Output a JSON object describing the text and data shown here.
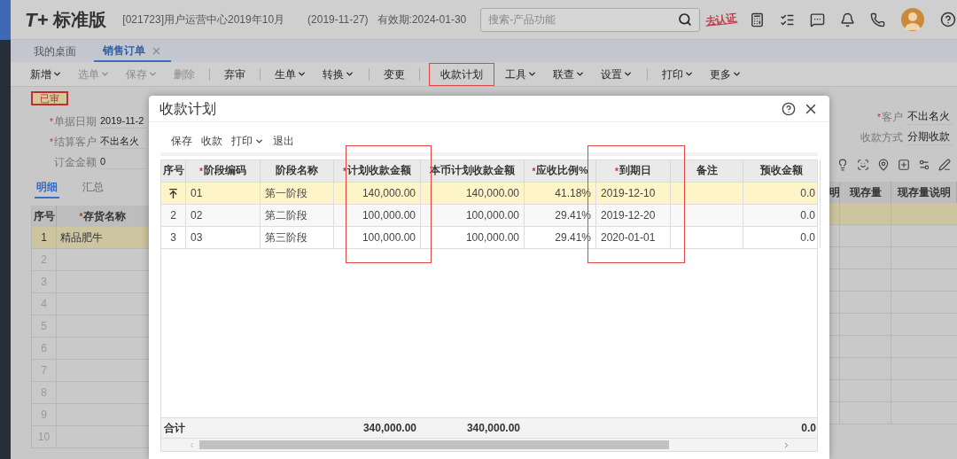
{
  "header": {
    "logo_mark": "T+",
    "product": "标准版",
    "account": "[021723]用户运营中心2019年10月",
    "date": "(2019-11-27)",
    "validity": "有效期:2024-01-30",
    "search": {
      "placeholder": "搜索-产品功能"
    },
    "certify_link": "去认证"
  },
  "tabs": [
    {
      "label": "我的桌面",
      "selected": false,
      "closable": false
    },
    {
      "label": "销售订单",
      "selected": true,
      "closable": true
    }
  ],
  "toolbar": [
    {
      "kind": "button",
      "label": "新增",
      "dropdown": true,
      "disabled": false,
      "highlighted": false
    },
    {
      "kind": "button",
      "label": "选单",
      "dropdown": true,
      "disabled": true,
      "highlighted": false
    },
    {
      "kind": "button",
      "label": "保存",
      "dropdown": true,
      "disabled": true,
      "highlighted": false
    },
    {
      "kind": "button",
      "label": "删除",
      "dropdown": false,
      "disabled": true,
      "highlighted": false
    },
    {
      "kind": "separator"
    },
    {
      "kind": "button",
      "label": "弃审",
      "dropdown": false,
      "disabled": false,
      "highlighted": false
    },
    {
      "kind": "separator"
    },
    {
      "kind": "button",
      "label": "生单",
      "dropdown": true,
      "disabled": false,
      "highlighted": false
    },
    {
      "kind": "button",
      "label": "转换",
      "dropdown": true,
      "disabled": false,
      "highlighted": false
    },
    {
      "kind": "separator"
    },
    {
      "kind": "button",
      "label": "变更",
      "dropdown": false,
      "disabled": false,
      "highlighted": false
    },
    {
      "kind": "separator"
    },
    {
      "kind": "button",
      "label": "收款计划",
      "dropdown": false,
      "disabled": false,
      "highlighted": true
    },
    {
      "kind": "button",
      "label": "工具",
      "dropdown": true,
      "disabled": false,
      "highlighted": false
    },
    {
      "kind": "button",
      "label": "联查",
      "dropdown": true,
      "disabled": false,
      "highlighted": false
    },
    {
      "kind": "button",
      "label": "设置",
      "dropdown": true,
      "disabled": false,
      "highlighted": false
    },
    {
      "kind": "separator"
    },
    {
      "kind": "button",
      "label": "打印",
      "dropdown": true,
      "disabled": false,
      "highlighted": false
    },
    {
      "kind": "button",
      "label": "更多",
      "dropdown": true,
      "disabled": false,
      "highlighted": false
    }
  ],
  "form": {
    "status": "已审",
    "fields_left": [
      {
        "mark": "*",
        "label": "单据日期",
        "value": "2019-11-2"
      },
      {
        "mark": "*",
        "label": "结算客户",
        "value": "不出名火"
      },
      {
        "label": "订金金额",
        "value": "0"
      }
    ],
    "fields_right": [
      {
        "mark": "*",
        "label": "客户",
        "value": "不出名火"
      },
      {
        "label": "收款方式",
        "value": "分期收款"
      }
    ]
  },
  "detail_tabs": [
    {
      "label": "明细",
      "selected": true
    },
    {
      "label": "汇总",
      "selected": false
    }
  ],
  "grid": {
    "columns_left": [
      {
        "label": "序号"
      },
      {
        "mark": "*",
        "label": "存货名称"
      }
    ],
    "columns_right": [
      {
        "label": "明"
      },
      {
        "label": "现存量"
      },
      {
        "label": "现存量说明"
      }
    ],
    "rows": [
      {
        "seq": "1",
        "name": "精品肥牛",
        "selected": true
      },
      {
        "seq": "2",
        "selected": false
      },
      {
        "seq": "3",
        "selected": false
      },
      {
        "seq": "4",
        "selected": false
      },
      {
        "seq": "5",
        "selected": false
      },
      {
        "seq": "6",
        "selected": false
      },
      {
        "seq": "7",
        "selected": false
      },
      {
        "seq": "8",
        "selected": false
      },
      {
        "seq": "9",
        "selected": false
      },
      {
        "seq": "10",
        "selected": false
      }
    ]
  },
  "modal": {
    "title": "收款计划",
    "toolbar": [
      {
        "label": "保存",
        "dropdown": false
      },
      {
        "label": "收款",
        "dropdown": false
      },
      {
        "label": "打印",
        "dropdown": true
      },
      {
        "label": "退出",
        "dropdown": false
      }
    ],
    "columns": [
      {
        "label": "序号",
        "highlighted": false
      },
      {
        "mark": "*",
        "label": "阶段编码",
        "highlighted": false
      },
      {
        "label": "阶段名称",
        "highlighted": false
      },
      {
        "mark": "*",
        "label": "计划收款金额",
        "highlighted": true
      },
      {
        "label": "本币计划收款金额",
        "highlighted": false
      },
      {
        "mark": "*",
        "label": "应收比例%",
        "highlighted": false
      },
      {
        "mark": "*",
        "label": "到期日",
        "highlighted": true
      },
      {
        "label": "备注",
        "highlighted": false
      },
      {
        "label": "预收金额",
        "highlighted": false
      }
    ],
    "rows": [
      {
        "selected": true,
        "cells": [
          "",
          "01",
          "第一阶段",
          "140,000.00",
          "140,000.00",
          "41.18%",
          "2019-12-10",
          "",
          "0.0"
        ]
      },
      {
        "selected": false,
        "cells": [
          "2",
          "02",
          "第二阶段",
          "100,000.00",
          "100,000.00",
          "29.41%",
          "2019-12-20",
          "",
          "0.0"
        ]
      },
      {
        "selected": false,
        "cells": [
          "3",
          "03",
          "第三阶段",
          "100,000.00",
          "100,000.00",
          "29.41%",
          "2020-01-01",
          "",
          "0.0"
        ]
      }
    ],
    "totals": {
      "cells": [
        "合计",
        "",
        "",
        "340,000.00",
        "340,000.00",
        "",
        "",
        "",
        "0.0"
      ]
    }
  }
}
